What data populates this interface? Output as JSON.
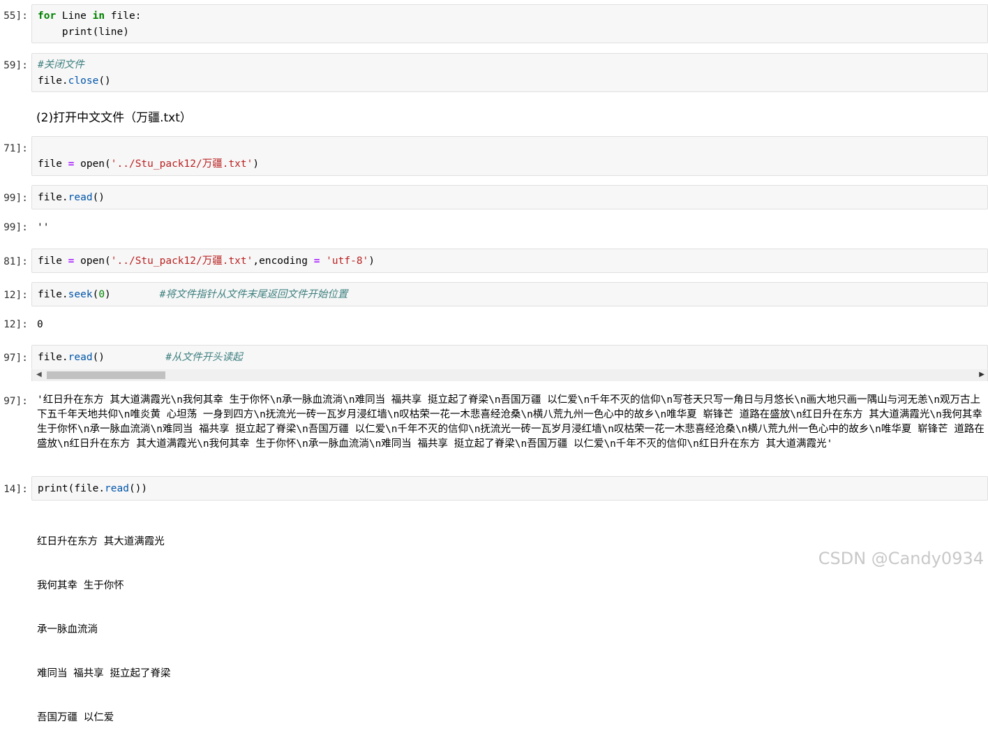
{
  "cells": {
    "c1": {
      "prompt": "55]:",
      "line1_kw": "for",
      "line1_var": " Line ",
      "line1_in": "in",
      "line1_rest": " file:",
      "line2": "    print(line)"
    },
    "c2": {
      "prompt": "59]:",
      "comment": "#关闭文件",
      "obj": "file",
      "method": "close",
      "tail": "()"
    },
    "md": {
      "text": "(2)打开中文文件（万疆.txt）"
    },
    "c3": {
      "prompt": "71]:",
      "var": "file ",
      "op": "=",
      "call": " open(",
      "str": "'../Stu_pack12/万疆.txt'",
      "tail": ")"
    },
    "c4": {
      "prompt": "99]:",
      "obj": "file",
      "method": "read",
      "tail": "()"
    },
    "o4": {
      "prompt": "99]:",
      "value": "''"
    },
    "c5": {
      "prompt": "81]:",
      "var": "file ",
      "op": "=",
      "call": " open(",
      "str": "'../Stu_pack12/万疆.txt'",
      "mid": ",encoding ",
      "op2": "=",
      "str2": " 'utf-8'",
      "tail": ")"
    },
    "c6": {
      "prompt": "12]:",
      "obj": "file",
      "method": "seek",
      "open": "(",
      "num": "0",
      "close": ")",
      "comment": "        #将文件指针从文件末尾返回文件开始位置"
    },
    "o6": {
      "prompt": "12]:",
      "value": "0"
    },
    "c7": {
      "prompt": "97]:",
      "obj": "file",
      "method": "read",
      "tail": "()",
      "comment": "          #从文件开头读起"
    },
    "o7": {
      "prompt": "97]:",
      "value": "'红日升在东方 其大道满霞光\\n我何其幸 生于你怀\\n承一脉血流淌\\n难同当 福共享 挺立起了脊梁\\n吾国万疆 以仁爱\\n千年不灭的信仰\\n写苍天只写一角日与月悠长\\n画大地只画一隅山与河无恙\\n观万古上下五千年天地共仰\\n唯炎黄 心坦荡 一身到四方\\n抚流光一砖一瓦岁月浸红墙\\n叹枯荣一花一木悲喜经沧桑\\n横八荒九州一色心中的故乡\\n唯华夏 崭锋芒 道路在盛放\\n红日升在东方 其大道满霞光\\n我何其幸 生于你怀\\n承一脉血流淌\\n难同当 福共享 挺立起了脊梁\\n吾国万疆 以仁爱\\n千年不灭的信仰\\n抚流光一砖一瓦岁月浸红墙\\n叹枯荣一花一木悲喜经沧桑\\n横八荒九州一色心中的故乡\\n唯华夏 崭锋芒 道路在盛放\\n红日升在东方 其大道满霞光\\n我何其幸 生于你怀\\n承一脉血流淌\\n难同当 福共享 挺立起了脊梁\\n吾国万疆 以仁爱\\n千年不灭的信仰\\n红日升在东方 其大道满霞光'"
    },
    "c8": {
      "prompt": "14]:",
      "func": "print",
      "open": "(",
      "obj": "file",
      "method": "read",
      "tail": "())"
    },
    "o8": {
      "lines": [
        "红日升在东方 其大道满霞光",
        "我何其幸 生于你怀",
        "承一脉血流淌",
        "难同当 福共享 挺立起了脊梁",
        "吾国万疆 以仁爱"
      ]
    }
  },
  "watermark": "CSDN @Candy0934",
  "scrollbar": {
    "left_arrow": "◀",
    "right_arrow": "▶"
  }
}
